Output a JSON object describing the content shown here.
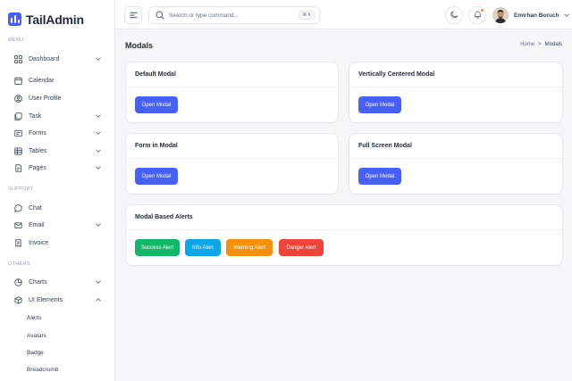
{
  "app": {
    "name": "TailAdmin"
  },
  "sidebar": {
    "sections": [
      "MENU",
      "SUPPORT",
      "OTHERS"
    ],
    "menu_items": [
      {
        "label": "Dashboard",
        "icon": "grid-icon",
        "has_chevron": true
      },
      {
        "label": "Calendar",
        "icon": "calendar-icon",
        "has_chevron": false
      },
      {
        "label": "User Profile",
        "icon": "user-circle-icon",
        "has_chevron": false
      },
      {
        "label": "Task",
        "icon": "task-icon",
        "has_chevron": true
      },
      {
        "label": "Forms",
        "icon": "form-icon",
        "has_chevron": true
      },
      {
        "label": "Tables",
        "icon": "table-icon",
        "has_chevron": true
      },
      {
        "label": "Pages",
        "icon": "pages-icon",
        "has_chevron": true
      }
    ],
    "support_items": [
      {
        "label": "Chat",
        "icon": "chat-icon",
        "has_chevron": false
      },
      {
        "label": "Email",
        "icon": "mail-icon",
        "has_chevron": true
      },
      {
        "label": "Invoice",
        "icon": "invoice-icon",
        "has_chevron": false
      }
    ],
    "others_items": [
      {
        "label": "Charts",
        "icon": "pie-chart-icon",
        "has_chevron": true
      },
      {
        "label": "UI Elements",
        "icon": "box-icon",
        "has_chevron": true,
        "expanded": true
      }
    ],
    "ui_sub_items": [
      "Alerts",
      "Avatars",
      "Badge",
      "Breadcrumb"
    ]
  },
  "header": {
    "search_placeholder": "Search or type command...",
    "search_shortcut": "⌘ K",
    "user_name": "Emirhan Boruch"
  },
  "page": {
    "title": "Modals",
    "breadcrumb": {
      "home": "Home",
      "separator": ">",
      "current": "Modals"
    }
  },
  "cards": {
    "default_modal": {
      "title": "Default Modal",
      "button": "Open Modal"
    },
    "vertically_centered": {
      "title": "Vertically Centered Modal",
      "button": "Open Modal"
    },
    "form_in_modal": {
      "title": "Form in Modal",
      "button": "Open Modal"
    },
    "full_screen": {
      "title": "Full Screen Modal",
      "button": "Open Modal"
    },
    "alerts": {
      "title": "Modal Based Alerts",
      "buttons": [
        {
          "label": "Success Alert",
          "color": "#12b76a"
        },
        {
          "label": "Info Alert",
          "color": "#0ba5ec"
        },
        {
          "label": "Warning Alert",
          "color": "#f79009"
        },
        {
          "label": "Danger Alert",
          "color": "#f04438"
        }
      ]
    }
  },
  "colors": {
    "brand": "#465fff",
    "notification": "#fd853a"
  }
}
